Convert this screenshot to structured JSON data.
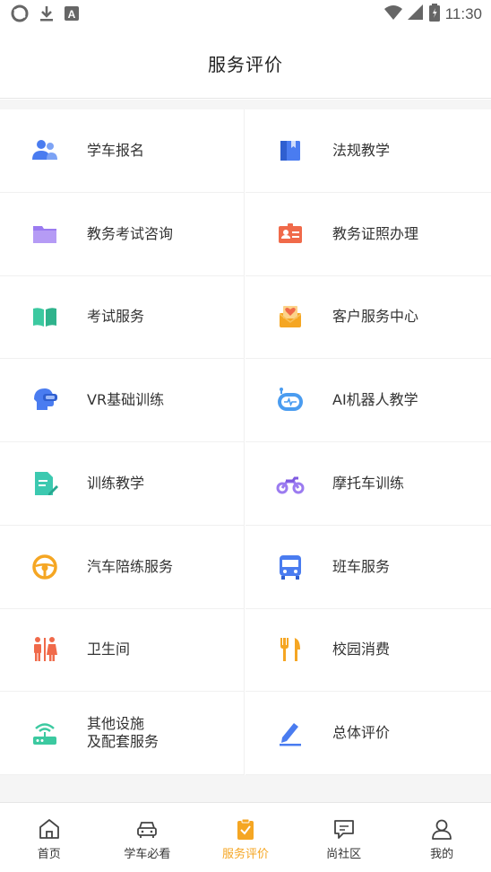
{
  "status_bar": {
    "time": "11:30",
    "left_icons": [
      "sync-icon",
      "download-icon",
      "font-icon"
    ],
    "right_icons": [
      "wifi-icon",
      "signal-icon",
      "battery-icon"
    ]
  },
  "header": {
    "title": "服务评价"
  },
  "services": [
    {
      "label": "学车报名",
      "icon": "users-icon",
      "color": "#4a7cf0"
    },
    {
      "label": "法规教学",
      "icon": "book-icon",
      "color": "#4a7cf0"
    },
    {
      "label": "教务考试咨询",
      "icon": "folder-icon",
      "color": "#9b7bf0"
    },
    {
      "label": "教务证照办理",
      "icon": "id-card-icon",
      "color": "#f06a4a"
    },
    {
      "label": "考试服务",
      "icon": "open-book-icon",
      "color": "#3cc9a0"
    },
    {
      "label": "客户服务中心",
      "icon": "mail-heart-icon",
      "color": "#f5a623"
    },
    {
      "label": "VR基础训练",
      "icon": "vr-head-icon",
      "color": "#4a7cf0"
    },
    {
      "label": "AI机器人教学",
      "icon": "robot-icon",
      "color": "#4a9cf0"
    },
    {
      "label": "训练教学",
      "icon": "doc-edit-icon",
      "color": "#3cc9b0"
    },
    {
      "label": "摩托车训练",
      "icon": "motorcycle-icon",
      "color": "#9b7bf0"
    },
    {
      "label": "汽车陪练服务",
      "icon": "steering-wheel-icon",
      "color": "#f5a623"
    },
    {
      "label": "班车服务",
      "icon": "bus-icon",
      "color": "#4a7cf0"
    },
    {
      "label": "卫生间",
      "icon": "restroom-icon",
      "color": "#f06a4a"
    },
    {
      "label": "校园消费",
      "icon": "fork-knife-icon",
      "color": "#f5a623"
    },
    {
      "label_lines": [
        "其他设施",
        "及配套服务"
      ],
      "icon": "router-icon",
      "color": "#3cc9a0"
    },
    {
      "label": "总体评价",
      "icon": "pen-icon",
      "color": "#4a7cf0"
    }
  ],
  "tabbar": [
    {
      "label": "首页",
      "icon": "home-icon",
      "active": false
    },
    {
      "label": "学车必看",
      "icon": "car-icon",
      "active": false
    },
    {
      "label": "服务评价",
      "icon": "clipboard-check-icon",
      "active": true
    },
    {
      "label": "尚社区",
      "icon": "chat-icon",
      "active": false
    },
    {
      "label": "我的",
      "icon": "user-icon",
      "active": false
    }
  ],
  "colors": {
    "accent": "#f5a623",
    "text": "#333333",
    "divider": "#f0f0f0"
  }
}
